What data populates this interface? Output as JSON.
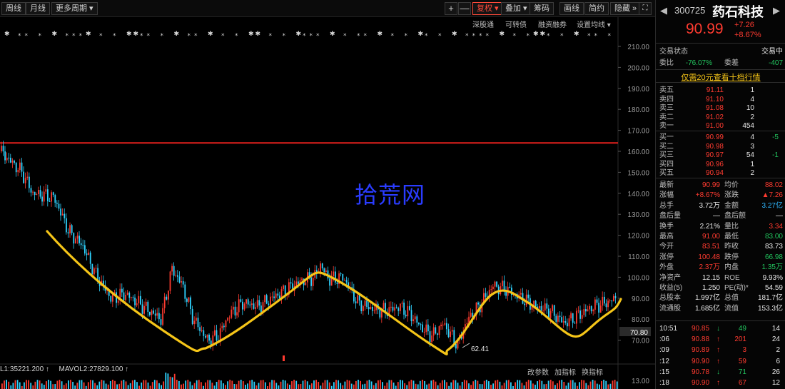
{
  "toolbar": {
    "left": [
      "周线",
      "月线",
      "更多周期 ▾"
    ],
    "right": [
      "复权 ▾",
      "叠加 ▾",
      "筹码",
      "画线",
      "简约",
      "隐藏 »"
    ],
    "plus": "+",
    "minus": "—"
  },
  "chart": {
    "subtabs": [
      "深股通",
      "可转债",
      "融资融券",
      "设置均线 ▾"
    ],
    "y_ticks": [
      "210.00",
      "200.00",
      "190.00",
      "180.00",
      "170.00",
      "160.00",
      "150.00",
      "140.00",
      "130.00",
      "120.00",
      "110.00",
      "100.00",
      "90.00",
      "80.00",
      "70.00"
    ],
    "current_price_label": "70.80",
    "low_label": "62.41",
    "vol_tick": "13.00",
    "resistance_price": 164,
    "watermark": "拾荒网",
    "vol_info_1": "L1:35221.200 ↑",
    "vol_info_2": "MAVOL2:27829.100 ↑",
    "vol_links": [
      "改参数",
      "加指标",
      "换指标"
    ],
    "colors": {
      "up": "#ff3b30",
      "down": "#2fd3ff",
      "resist": "#e2211c",
      "trend": "#f5c518"
    }
  },
  "panel": {
    "code": "300725",
    "name": "药石科技",
    "price": "90.99",
    "change": "+7.26",
    "change_pct": "+8.67%",
    "trade_status_label": "交易状态",
    "trade_status": "交易中",
    "webi_label": "委比",
    "webi": "-76.07%",
    "weicha_label": "委差",
    "weicha": "-407",
    "promo": "仅需20元查看十档行情",
    "asks": [
      {
        "label": "卖五",
        "price": "91.11",
        "vol": "1",
        "chg": ""
      },
      {
        "label": "卖四",
        "price": "91.10",
        "vol": "4",
        "chg": ""
      },
      {
        "label": "卖三",
        "price": "91.08",
        "vol": "10",
        "chg": ""
      },
      {
        "label": "卖二",
        "price": "91.02",
        "vol": "2",
        "chg": ""
      },
      {
        "label": "卖一",
        "price": "91.00",
        "vol": "454",
        "chg": ""
      }
    ],
    "bids": [
      {
        "label": "买一",
        "price": "90.99",
        "vol": "4",
        "chg": "-5"
      },
      {
        "label": "买二",
        "price": "90.98",
        "vol": "3",
        "chg": ""
      },
      {
        "label": "买三",
        "price": "90.97",
        "vol": "54",
        "chg": "-1"
      },
      {
        "label": "买四",
        "price": "90.96",
        "vol": "1",
        "chg": ""
      },
      {
        "label": "买五",
        "price": "90.94",
        "vol": "2",
        "chg": ""
      }
    ],
    "stats": [
      {
        "k1": "最新",
        "v1": "90.99",
        "c1": "red",
        "k2": "均价",
        "v2": "88.02",
        "c2": "red"
      },
      {
        "k1": "涨幅",
        "v1": "+8.67%",
        "c1": "red",
        "k2": "涨跌",
        "v2": "▲7.26",
        "c2": "red"
      },
      {
        "k1": "总手",
        "v1": "3.72万",
        "c1": "white",
        "k2": "金额",
        "v2": "3.27亿",
        "c2": "cyan"
      },
      {
        "k1": "盘后量",
        "v1": "—",
        "c1": "white",
        "k2": "盘后额",
        "v2": "—",
        "c2": "white"
      },
      {
        "k1": "换手",
        "v1": "2.21%",
        "c1": "white",
        "k2": "量比",
        "v2": "3.34",
        "c2": "red"
      },
      {
        "k1": "最高",
        "v1": "91.00",
        "c1": "red",
        "k2": "最低",
        "v2": "83.00",
        "c2": "green"
      },
      {
        "k1": "今开",
        "v1": "83.51",
        "c1": "red",
        "k2": "昨收",
        "v2": "83.73",
        "c2": "white"
      },
      {
        "k1": "涨停",
        "v1": "100.48",
        "c1": "red",
        "k2": "跌停",
        "v2": "66.98",
        "c2": "green"
      },
      {
        "k1": "外盘",
        "v1": "2.37万",
        "c1": "red",
        "k2": "内盘",
        "v2": "1.35万",
        "c2": "green"
      },
      {
        "k1": "净资产",
        "v1": "12.15",
        "c1": "white",
        "k2": "ROE",
        "v2": "9.93%",
        "c2": "white"
      },
      {
        "k1": "收益(5)",
        "v1": "1.250",
        "c1": "white",
        "k2": "PE(动)*",
        "v2": "54.59",
        "c2": "white"
      },
      {
        "k1": "总股本",
        "v1": "1.997亿",
        "c1": "white",
        "k2": "总值",
        "v2": "181.7亿",
        "c2": "white"
      },
      {
        "k1": "流通股",
        "v1": "1.685亿",
        "c1": "white",
        "k2": "流值",
        "v2": "153.3亿",
        "c2": "white"
      }
    ],
    "ticks": [
      {
        "t": "10:51",
        "p": "90.85",
        "arrow": "↓",
        "v": "49",
        "n": "14",
        "vc": "green"
      },
      {
        "t": ":06",
        "p": "90.88",
        "arrow": "↑",
        "v": "201",
        "n": "24",
        "vc": "red"
      },
      {
        "t": ":09",
        "p": "90.89",
        "arrow": "↑",
        "v": "3",
        "n": "2",
        "vc": "red"
      },
      {
        "t": ":12",
        "p": "90.90",
        "arrow": "↑",
        "v": "59",
        "n": "6",
        "vc": "red"
      },
      {
        "t": ":15",
        "p": "90.78",
        "arrow": "↓",
        "v": "71",
        "n": "26",
        "vc": "green"
      },
      {
        "t": ":18",
        "p": "90.90",
        "arrow": "↑",
        "v": "67",
        "n": "12",
        "vc": "red"
      }
    ]
  }
}
